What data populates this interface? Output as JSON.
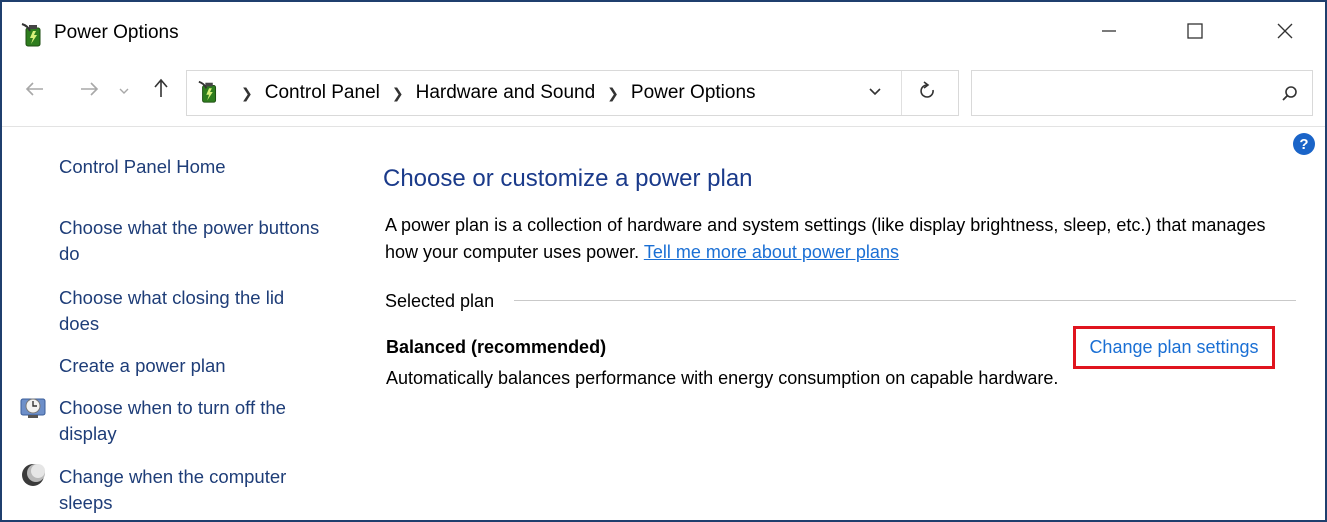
{
  "window": {
    "title": "Power Options",
    "icon": "power-options-battery-icon"
  },
  "controls": {
    "minimize": "minimize-icon",
    "maximize": "maximize-icon",
    "close": "close-icon"
  },
  "navigation": {
    "breadcrumbs": [
      "Control Panel",
      "Hardware and Sound",
      "Power Options"
    ],
    "search_placeholder": ""
  },
  "sidebar": {
    "home": "Control Panel Home",
    "items": [
      {
        "label": "Choose what the power buttons do",
        "icon": ""
      },
      {
        "label": "Choose what closing the lid does",
        "icon": ""
      },
      {
        "label": "Create a power plan",
        "icon": ""
      },
      {
        "label": "Choose when to turn off the display",
        "icon": "display-clock-icon"
      },
      {
        "label": "Change when the computer sleeps",
        "icon": "moon-sleep-icon"
      }
    ]
  },
  "main": {
    "title": "Choose or customize a power plan",
    "description": "A power plan is a collection of hardware and system settings (like display brightness, sleep, etc.) that manages how your computer uses power.",
    "description_link": "Tell me more about power plans",
    "selected_plan_label": "Selected plan",
    "plan": {
      "name": "Balanced (recommended)",
      "description": "Automatically balances performance with energy consumption on capable hardware.",
      "change_link": "Change plan settings"
    }
  },
  "colors": {
    "link": "#1a6fd4",
    "title": "#1a3a8a",
    "highlight_border": "#e0141e",
    "help": "#1a64c8"
  }
}
